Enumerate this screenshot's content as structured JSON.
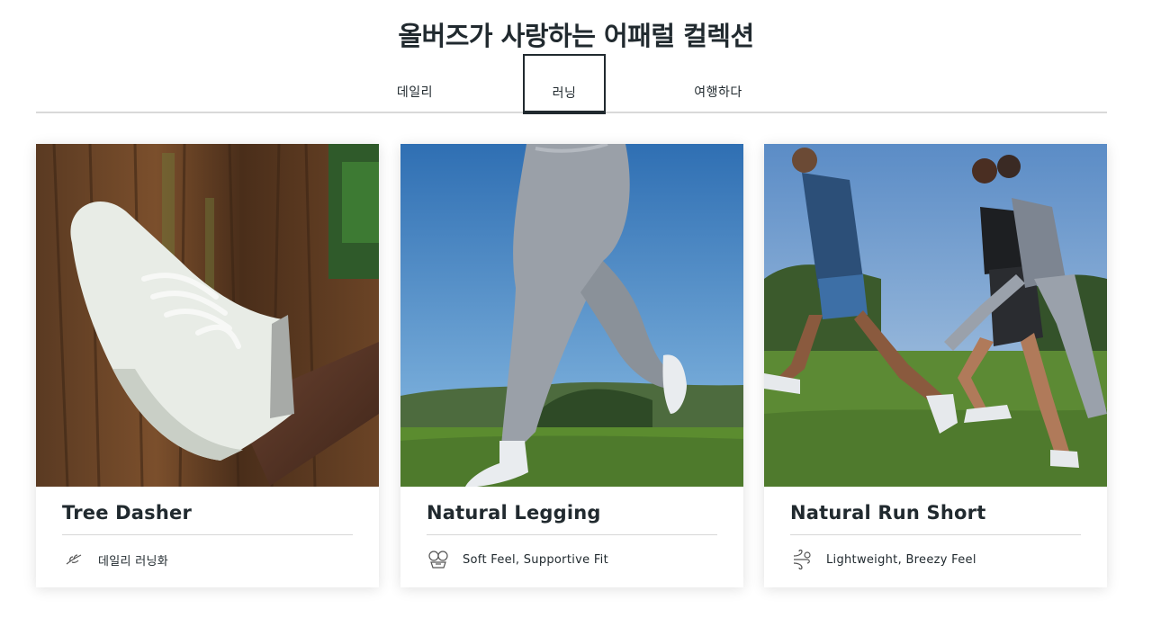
{
  "header": {
    "title": "올버즈가 사랑하는 어패럴 컬렉션"
  },
  "tabs": [
    {
      "label": "데일리",
      "selected": false
    },
    {
      "label": "러닝",
      "selected": true
    },
    {
      "label": "여행하다",
      "selected": false
    }
  ],
  "products": [
    {
      "name": "Tree Dasher",
      "feature": "데일리 러닝화",
      "icon": "leaf-sprig-icon"
    },
    {
      "name": "Natural Legging",
      "feature": "Soft Feel, Supportive Fit",
      "icon": "fabric-stretch-icon"
    },
    {
      "name": "Natural Run Short",
      "feature": "Lightweight, Breezy Feel",
      "icon": "breeze-icon"
    }
  ],
  "colors": {
    "text": "#212a2f",
    "divider": "#d9d9d9",
    "sky": "#4f8fc7",
    "grass": "#4e7a2c"
  }
}
